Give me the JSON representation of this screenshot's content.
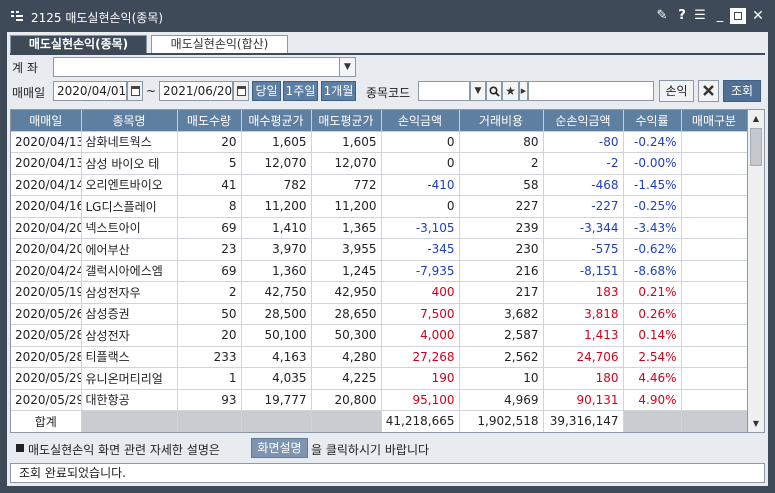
{
  "window": {
    "title": "2125 매도실현손익(종목)",
    "controls": [
      "pin-icon",
      "help-icon",
      "menu-icon",
      "minimize-icon",
      "maximize-icon",
      "close-icon"
    ]
  },
  "tabs": [
    {
      "label": "매도실현손익(종목)",
      "active": true
    },
    {
      "label": "매도실현손익(합산)",
      "active": false
    }
  ],
  "filters": {
    "account_label": "계  좌",
    "account_value": "",
    "sell_date_label": "매매일",
    "date_from": "2020/04/01",
    "date_sep": "~",
    "date_to": "2021/06/20",
    "period_buttons": [
      "당일",
      "1주일",
      "1개월"
    ],
    "stock_code_label": "종목코드",
    "stock_code_value": "",
    "stock_name_value": "",
    "sort_button": "손익",
    "query_button": "조회"
  },
  "table": {
    "columns": [
      "매매일",
      "종목명",
      "매도수량",
      "매수평균가",
      "매도평균가",
      "손익금액",
      "거래비용",
      "순손익금액",
      "수익률",
      "매매구분"
    ],
    "rows": [
      {
        "date": "2020/04/13",
        "name": "삼화네트웍스",
        "qty": "20",
        "buy_avg": "1,605",
        "sell_avg": "1,605",
        "pl": "0",
        "cost": "80",
        "net_pl": "-80",
        "rate": "-0.24%",
        "type": "",
        "sign": "neg"
      },
      {
        "date": "2020/04/13",
        "name": "삼성 바이오 테",
        "qty": "5",
        "buy_avg": "12,070",
        "sell_avg": "12,070",
        "pl": "0",
        "cost": "2",
        "net_pl": "-2",
        "rate": "-0.00%",
        "type": "",
        "sign": "neg"
      },
      {
        "date": "2020/04/14",
        "name": "오리엔트바이오",
        "qty": "41",
        "buy_avg": "782",
        "sell_avg": "772",
        "pl": "-410",
        "cost": "58",
        "net_pl": "-468",
        "rate": "-1.45%",
        "type": "",
        "sign": "neg"
      },
      {
        "date": "2020/04/16",
        "name": "LG디스플레이",
        "qty": "8",
        "buy_avg": "11,200",
        "sell_avg": "11,200",
        "pl": "0",
        "cost": "227",
        "net_pl": "-227",
        "rate": "-0.25%",
        "type": "",
        "sign": "neg"
      },
      {
        "date": "2020/04/20",
        "name": "넥스트아이",
        "qty": "69",
        "buy_avg": "1,410",
        "sell_avg": "1,365",
        "pl": "-3,105",
        "cost": "239",
        "net_pl": "-3,344",
        "rate": "-3.43%",
        "type": "",
        "sign": "neg"
      },
      {
        "date": "2020/04/20",
        "name": "에어부산",
        "qty": "23",
        "buy_avg": "3,970",
        "sell_avg": "3,955",
        "pl": "-345",
        "cost": "230",
        "net_pl": "-575",
        "rate": "-0.62%",
        "type": "",
        "sign": "neg"
      },
      {
        "date": "2020/04/24",
        "name": "갤럭시아에스엠",
        "qty": "69",
        "buy_avg": "1,360",
        "sell_avg": "1,245",
        "pl": "-7,935",
        "cost": "216",
        "net_pl": "-8,151",
        "rate": "-8.68%",
        "type": "",
        "sign": "neg"
      },
      {
        "date": "2020/05/19",
        "name": "삼성전자우",
        "qty": "2",
        "buy_avg": "42,750",
        "sell_avg": "42,950",
        "pl": "400",
        "cost": "217",
        "net_pl": "183",
        "rate": "0.21%",
        "type": "",
        "sign": "pos"
      },
      {
        "date": "2020/05/26",
        "name": "삼성증권",
        "qty": "50",
        "buy_avg": "28,500",
        "sell_avg": "28,650",
        "pl": "7,500",
        "cost": "3,682",
        "net_pl": "3,818",
        "rate": "0.26%",
        "type": "",
        "sign": "pos"
      },
      {
        "date": "2020/05/28",
        "name": "삼성전자",
        "qty": "20",
        "buy_avg": "50,100",
        "sell_avg": "50,300",
        "pl": "4,000",
        "cost": "2,587",
        "net_pl": "1,413",
        "rate": "0.14%",
        "type": "",
        "sign": "pos"
      },
      {
        "date": "2020/05/28",
        "name": "티플랙스",
        "qty": "233",
        "buy_avg": "4,163",
        "sell_avg": "4,280",
        "pl": "27,268",
        "cost": "2,562",
        "net_pl": "24,706",
        "rate": "2.54%",
        "type": "",
        "sign": "pos"
      },
      {
        "date": "2020/05/29",
        "name": "유니온머티리얼",
        "qty": "1",
        "buy_avg": "4,035",
        "sell_avg": "4,225",
        "pl": "190",
        "cost": "10",
        "net_pl": "180",
        "rate": "4.46%",
        "type": "",
        "sign": "pos"
      },
      {
        "date": "2020/05/29",
        "name": "대한항공",
        "qty": "93",
        "buy_avg": "19,777",
        "sell_avg": "20,800",
        "pl": "95,100",
        "cost": "4,969",
        "net_pl": "90,131",
        "rate": "4.90%",
        "type": "",
        "sign": "pos"
      }
    ],
    "summary": {
      "label": "합계",
      "pl": "41,218,665",
      "cost": "1,902,518",
      "net_pl": "39,316,147"
    }
  },
  "help": {
    "text_before": "매도실현손익 화면 관련 자세한 설명은",
    "button": "화면설명",
    "text_after": "을 클릭하시기 바랍니다"
  },
  "status": {
    "message": "조회 완료되었습니다."
  },
  "colors": {
    "titlebar": "#3f4a58",
    "header": "#5f7fa1",
    "positive": "#d0021b",
    "negative": "#1f3fbf"
  }
}
